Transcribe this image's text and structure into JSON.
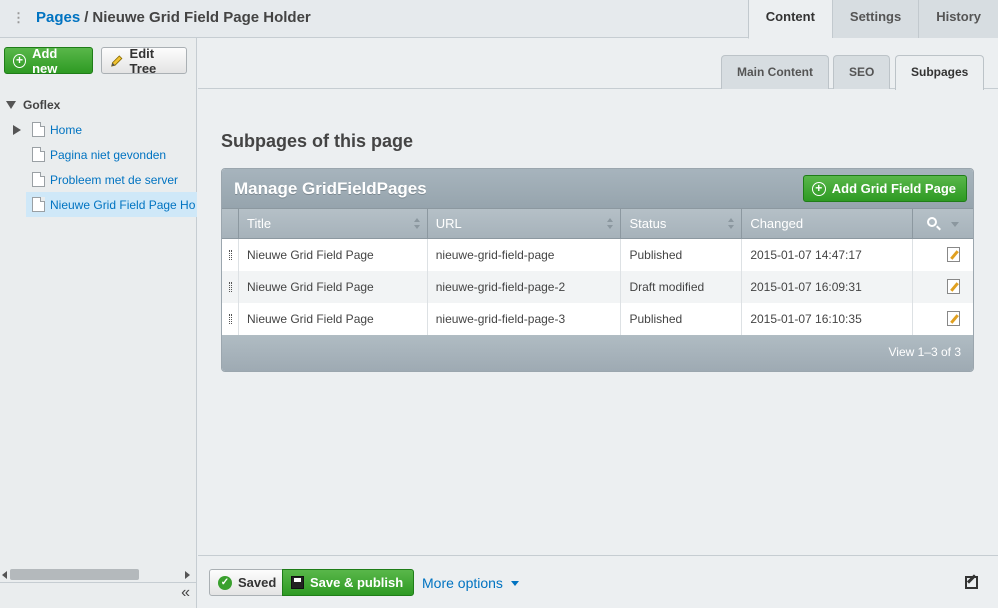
{
  "header": {
    "breadcrumb_root": "Pages",
    "breadcrumb_sep": "/",
    "breadcrumb_current": "Nieuwe Grid Field Page Holder",
    "tabs": [
      "Content",
      "Settings",
      "History"
    ]
  },
  "sidebar": {
    "add_new": "Add new",
    "edit_tree": "Edit Tree",
    "root": "Goflex",
    "items": [
      "Home",
      "Pagina niet gevonden",
      "Probleem met de server",
      "Nieuwe Grid Field Page Ho"
    ]
  },
  "subtabs": [
    "Main Content",
    "SEO",
    "Subpages"
  ],
  "main": {
    "title": "Subpages of this page",
    "grid_title": "Manage GridFieldPages",
    "add_button": "Add Grid Field Page",
    "columns": [
      "Title",
      "URL",
      "Status",
      "Changed"
    ],
    "rows": [
      [
        "Nieuwe Grid Field Page",
        "nieuwe-grid-field-page",
        "Published",
        "2015-01-07 14:47:17"
      ],
      [
        "Nieuwe Grid Field Page",
        "nieuwe-grid-field-page-2",
        "Draft modified",
        "2015-01-07 16:09:31"
      ],
      [
        "Nieuwe Grid Field Page",
        "nieuwe-grid-field-page-3",
        "Published",
        "2015-01-07 16:10:35"
      ]
    ],
    "pagination": "View 1–3 of 3"
  },
  "footer": {
    "saved": "Saved",
    "publish": "Save & publish",
    "more": "More options",
    "collapse": "«"
  },
  "colors": {
    "link": "#0073c1",
    "green": "#2e9a23",
    "grid_header": "#a0adb6"
  }
}
